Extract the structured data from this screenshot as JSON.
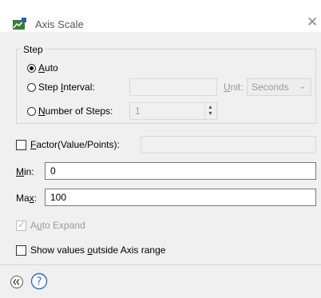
{
  "window": {
    "title": "Axis Scale",
    "close_glyph": "✕",
    "app_icon": "chart-icon"
  },
  "step_group": {
    "label": "Step",
    "auto": {
      "pre": "",
      "ul": "A",
      "post": "uto",
      "selected": true
    },
    "step_interval": {
      "pre": "Step ",
      "ul": "I",
      "post": "nterval:",
      "selected": false,
      "value": ""
    },
    "unit": {
      "pre": "",
      "ul": "U",
      "post": "nit:",
      "value": "Seconds"
    },
    "number_of_steps": {
      "pre": "",
      "ul": "N",
      "post": "umber of Steps:",
      "selected": false,
      "value": "1"
    }
  },
  "factor": {
    "pre": "",
    "ul": "F",
    "post": "actor(Value/Points):",
    "checked": false,
    "value": ""
  },
  "min": {
    "pre": "",
    "ul": "M",
    "post": "in:",
    "value": "0"
  },
  "max": {
    "pre": "Ma",
    "ul": "x",
    "post": ":",
    "value": "100"
  },
  "auto_expand": {
    "pre": "A",
    "ul": "u",
    "post": "to Expand",
    "checked": true,
    "disabled": true
  },
  "show_outside": {
    "pre": "Show values ",
    "ul": "o",
    "post": "utside Axis range",
    "checked": false
  },
  "footer": {
    "collapse_icon": "double-chevron-left-icon",
    "help_icon": "help-icon",
    "collapse_glyph": "«",
    "help_glyph": "?"
  },
  "colors": {
    "dialog_bg": "#f0f0f0",
    "title_bg": "#ffffff",
    "help_blue": "#2f6fb3"
  }
}
